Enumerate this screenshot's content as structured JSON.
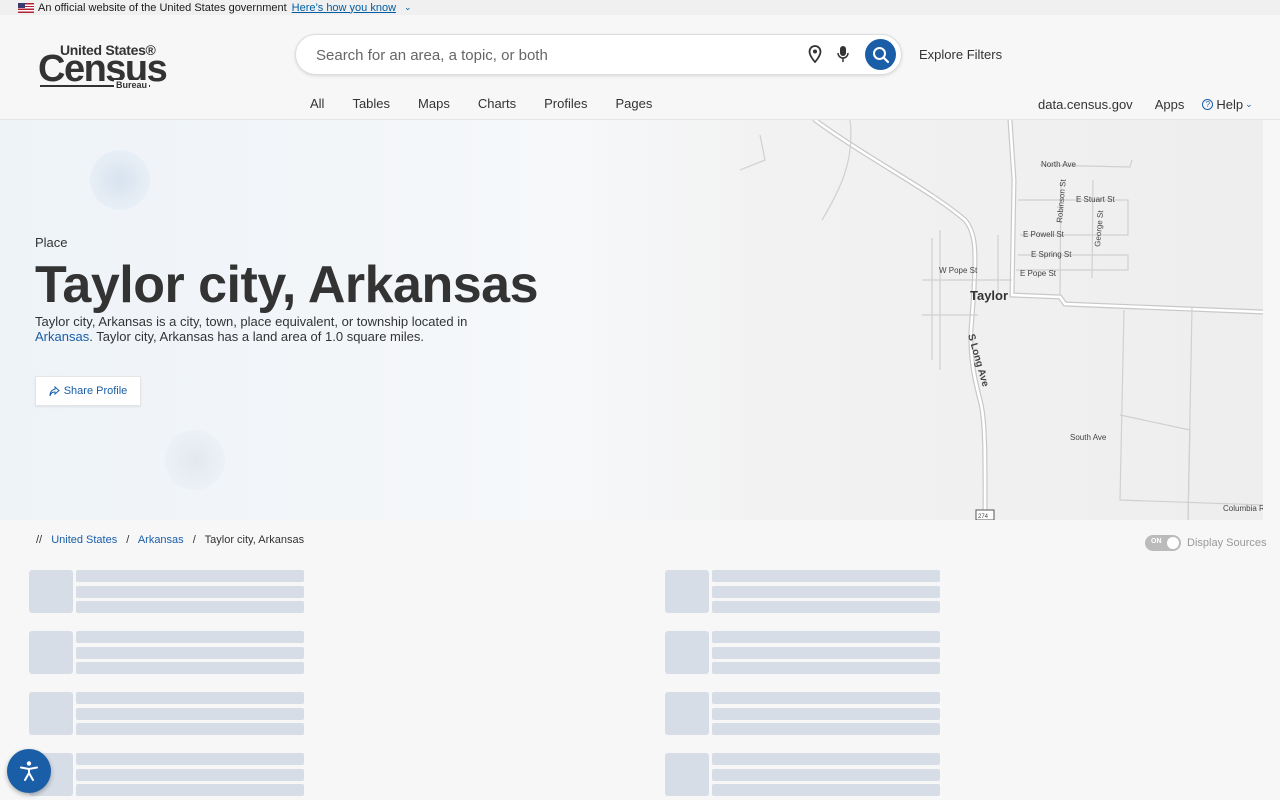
{
  "banner": {
    "text": "An official website of the United States government",
    "link": "Here’s how you know"
  },
  "logo": {
    "line1": "United States®",
    "line2": "Census",
    "line3": "Bureau"
  },
  "search": {
    "placeholder": "Search for an area, a topic, or both",
    "explore_label": "Explore Filters"
  },
  "nav": {
    "tabs": [
      "All",
      "Tables",
      "Maps",
      "Charts",
      "Profiles",
      "Pages"
    ],
    "right": {
      "site": "data.census.gov",
      "apps": "Apps",
      "help": "Help"
    }
  },
  "hero": {
    "place_type": "Place",
    "title": "Taylor city, Arkansas",
    "desc_before": "Taylor city, Arkansas is a city, town, place equivalent, or township located in ",
    "desc_link": "Arkansas",
    "desc_after": ". Taylor city, Arkansas has a land area of 1.0 square miles.",
    "share_label": "Share Profile"
  },
  "map": {
    "labels": {
      "north_ave": "North Ave",
      "robinson_st": "Robinson St",
      "e_stuart_st": "E Stuart St",
      "george_st": "George St",
      "e_powell_st": "E Powell St",
      "e_spring_st": "E Spring St",
      "w_pope_st": "W Pope St",
      "e_pope_st": "E Pope St",
      "taylor": "Taylor",
      "s_long_ave": "S Long Ave",
      "south_ave": "South Ave",
      "columbia": "Columbia R",
      "route": "274"
    }
  },
  "breadcrumb": {
    "root": "//",
    "items": [
      "United States",
      "Arkansas",
      "Taylor city, Arkansas"
    ]
  },
  "sources": {
    "toggle_state": "ON",
    "label": "Display Sources"
  },
  "colors": {
    "accent": "#1a5ea8",
    "skeleton": "#d6dde6"
  }
}
